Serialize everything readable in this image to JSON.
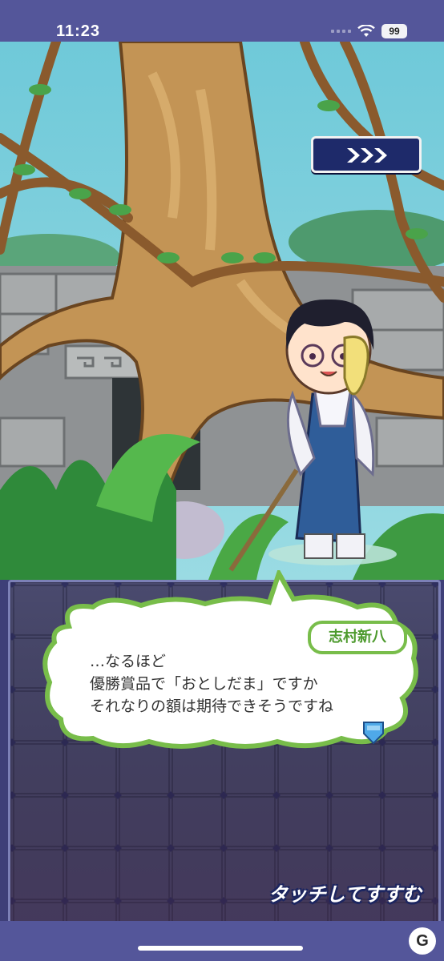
{
  "status_bar": {
    "time": "11:23",
    "battery": "99"
  },
  "scene": {
    "skip_button_icon": "triple-chevron-right-icon"
  },
  "dialogue": {
    "speaker": "志村新八",
    "lines": [
      "…なるほど",
      "優勝賞品で「おとしだま」ですか",
      "それなりの額は期待できそうですね"
    ],
    "advance_icon": "shield-arrow-icon"
  },
  "touch_prompt": "タッチしてすすむ",
  "colors": {
    "accent_green": "#78bd4a",
    "board_bg": "#4a4a6e",
    "frame": "#54569a"
  }
}
